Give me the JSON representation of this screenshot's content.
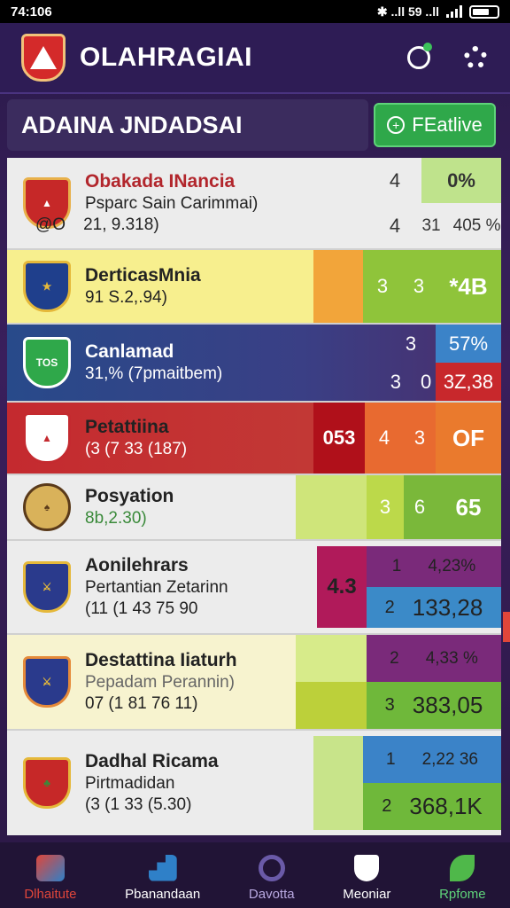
{
  "status_bar": {
    "time": "74:106",
    "indicators": "✱ ..ll 59 ..ll"
  },
  "header": {
    "title": "OLAHRAGIAI",
    "icons": [
      "logo-shield-icon",
      "bell-icon",
      "gear-icon"
    ]
  },
  "subheader": {
    "title": "ADAINA JNDADSAI",
    "button_label": "FEatlive",
    "button_icon": "plus-icon"
  },
  "rows": [
    {
      "name": "Obakada INancia",
      "sub": "Psparc Sain Carimmai)",
      "badge_text": "@O",
      "num": "21, 9.318)",
      "cells": {
        "c1": "4",
        "c2": "0%",
        "c3": "4",
        "c4": "31",
        "c5": "405 %"
      }
    },
    {
      "name": "DerticasMnia",
      "sub": "",
      "num": "91 S.2,.94)",
      "cells": {
        "c1": "3",
        "c2": "3",
        "c3": "*4B"
      }
    },
    {
      "name": "Canlamad",
      "sub": "31,% (7pmaitbem)",
      "badge_text": "TOS",
      "cells": {
        "c1": "3",
        "c2": "57%",
        "c3": "3",
        "c4": "0",
        "c5": "3Z,38"
      }
    },
    {
      "name": "Petattiina",
      "sub": "(3 (7 33 (187)",
      "cells": {
        "c0": "053",
        "c1": "4",
        "c2": "3",
        "c3": "OF"
      }
    },
    {
      "name": "Posyation",
      "sub": "",
      "num": "8b,2.30)",
      "cells": {
        "c1": "3",
        "c2": "6",
        "c3": "65"
      }
    },
    {
      "name": "Aonilehrars",
      "sub": "Pertantian Zetarinn",
      "num": "(11 (1 43 75 90",
      "cells": {
        "c0": "4.3",
        "c1": "1",
        "c2": "4,23%",
        "c3": "2",
        "c4": "133,28"
      }
    },
    {
      "name": "Destattina Iiaturh",
      "sub": "Pepadam Perannin)",
      "num": "07 (1 81 76 11)",
      "cells": {
        "c1": "2",
        "c2": "4,33 %",
        "c3": "3",
        "c4": "383,05"
      }
    },
    {
      "name": "Dadhal Ricama",
      "sub": "Pirtmadidan",
      "num": "(3 (1 33 (5.30)",
      "cells": {
        "c1": "1",
        "c2": "2,22 36",
        "c3": "2",
        "c4": "368,1K"
      }
    }
  ],
  "bottom_nav": [
    {
      "label": "Dlhaitute",
      "color": "#e0463a"
    },
    {
      "label": "Pbanandaan",
      "color": "#ffffff"
    },
    {
      "label": "Davotta",
      "color": "#b8a8e0"
    },
    {
      "label": "Meoniar",
      "color": "#ffffff"
    },
    {
      "label": "Rpfome",
      "color": "#5fd37a"
    }
  ]
}
